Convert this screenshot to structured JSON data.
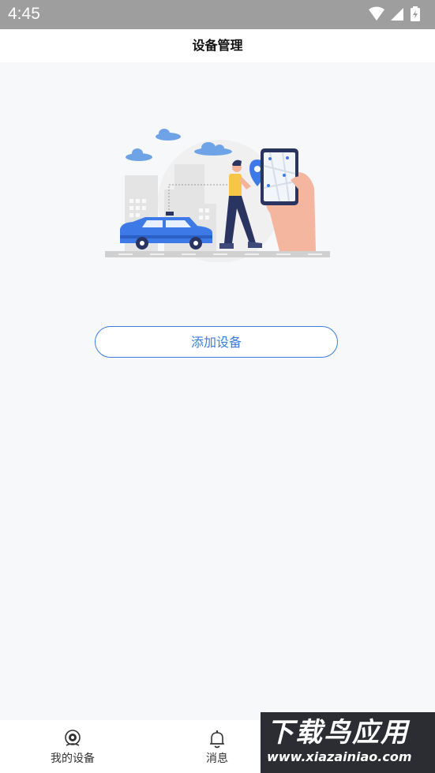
{
  "status_bar": {
    "time": "4:45",
    "icons": [
      "wifi-icon",
      "signal-icon",
      "battery-charging-icon"
    ]
  },
  "header": {
    "title": "设备管理"
  },
  "main": {
    "add_device_label": "添加设备",
    "colors": {
      "accent": "#3a7ee0",
      "background": "#f7f8f9"
    }
  },
  "tabbar": {
    "tabs": [
      {
        "label": "我的设备",
        "icon": "camera-icon"
      },
      {
        "label": "消息",
        "icon": "bell-icon"
      }
    ]
  },
  "watermark": {
    "title": "下载鸟应用",
    "url": "www.xiazainiao.com"
  }
}
